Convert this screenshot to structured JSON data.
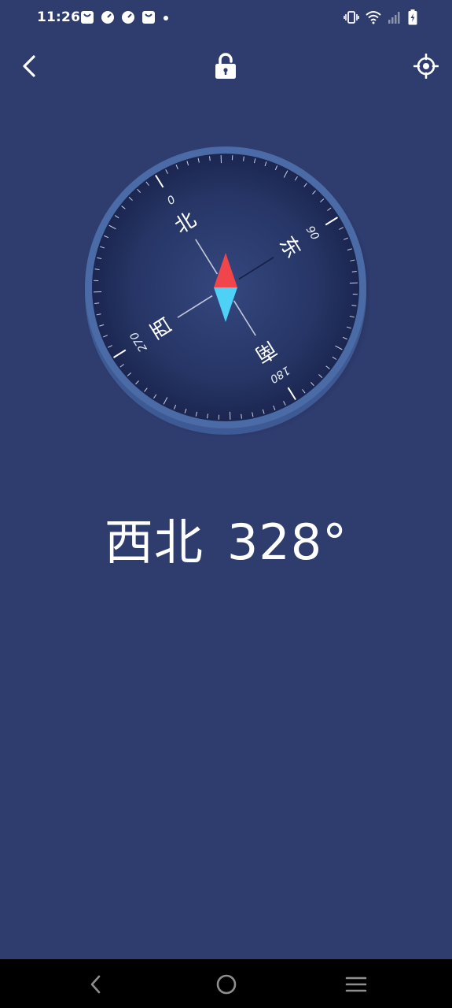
{
  "status_bar": {
    "time": "11:26",
    "left_icons": [
      "shopping-bag-icon",
      "speedometer-icon",
      "speedometer-icon",
      "shopping-bag-icon",
      "notification-dot-icon"
    ],
    "right_icons": [
      "vibrate-icon",
      "wifi-icon",
      "cellular-signal-icon",
      "battery-charging-icon"
    ]
  },
  "top_bar": {
    "left_icon": "back-chevron-icon",
    "center_icon": "unlocked-padlock-icon",
    "right_icon": "locate-crosshair-icon"
  },
  "compass": {
    "rotation_deg": -32,
    "directions": {
      "north": "北",
      "east": "东",
      "south": "南",
      "west": "西"
    },
    "degree_labels": {
      "north": "0",
      "east": "90",
      "south": "180",
      "west": "270"
    },
    "needle_colors": {
      "north": "#f0454b",
      "south": "#4fd1f7"
    },
    "bezel_color": "#4a6aa6",
    "dial_color": "#1f2c58"
  },
  "heading": {
    "direction": "西北",
    "degrees": "328°"
  },
  "nav_bar": {
    "icons": [
      "nav-back-icon",
      "nav-home-icon",
      "nav-recents-icon"
    ]
  }
}
